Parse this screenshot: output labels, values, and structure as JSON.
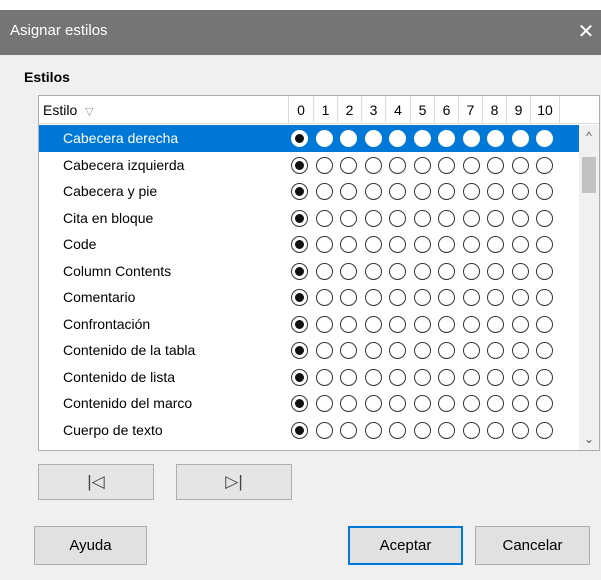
{
  "window": {
    "title": "Asignar estilos",
    "close_glyph": "✕"
  },
  "section": {
    "label": "Estilos"
  },
  "grid": {
    "column_header": "Estilo",
    "sort_glyph": "▽",
    "level_headers": [
      "0",
      "1",
      "2",
      "3",
      "4",
      "5",
      "6",
      "7",
      "8",
      "9",
      "10"
    ],
    "rows": [
      {
        "label": "Cabecera derecha",
        "selected": true,
        "level": 0
      },
      {
        "label": "Cabecera izquierda",
        "selected": false,
        "level": 0
      },
      {
        "label": "Cabecera y pie",
        "selected": false,
        "level": 0
      },
      {
        "label": "Cita en bloque",
        "selected": false,
        "level": 0
      },
      {
        "label": "Code",
        "selected": false,
        "level": 0
      },
      {
        "label": "Column Contents",
        "selected": false,
        "level": 0
      },
      {
        "label": "Comentario",
        "selected": false,
        "level": 0
      },
      {
        "label": "Confrontación",
        "selected": false,
        "level": 0
      },
      {
        "label": "Contenido de la tabla",
        "selected": false,
        "level": 0
      },
      {
        "label": "Contenido de lista",
        "selected": false,
        "level": 0
      },
      {
        "label": "Contenido del marco",
        "selected": false,
        "level": 0
      },
      {
        "label": "Cuerpo de texto",
        "selected": false,
        "level": 0
      }
    ],
    "scroll_up_glyph": "^",
    "scroll_down_glyph": "⌄"
  },
  "navigation": {
    "first_glyph": "|◁",
    "last_glyph": "▷|"
  },
  "buttons": {
    "help": "Ayuda",
    "ok": "Aceptar",
    "cancel": "Cancelar"
  },
  "colors": {
    "selection": "#0078d7",
    "titlebar": "#757575"
  }
}
